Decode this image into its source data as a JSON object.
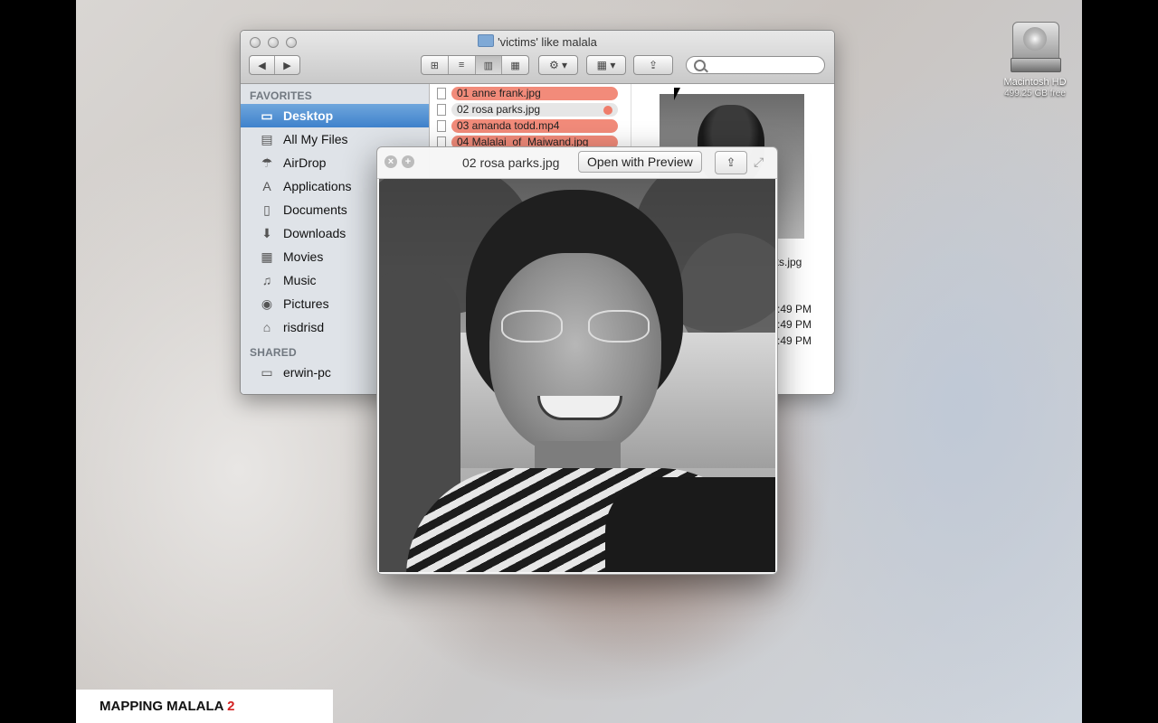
{
  "finder": {
    "title": "'victims' like malala",
    "toolbar": {
      "back": "◀",
      "forward": "▶",
      "view_icons": "⊞",
      "view_list": "≡",
      "view_columns": "▥",
      "view_coverflow": "▦",
      "action": "⚙ ▾",
      "arrange": "▦ ▾",
      "share": "⇪",
      "search_placeholder": ""
    },
    "sidebar": {
      "favorites_header": "FAVORITES",
      "items": [
        {
          "label": "Desktop",
          "icon": "▭"
        },
        {
          "label": "All My Files",
          "icon": "▤"
        },
        {
          "label": "AirDrop",
          "icon": "☂"
        },
        {
          "label": "Applications",
          "icon": "A"
        },
        {
          "label": "Documents",
          "icon": "▯"
        },
        {
          "label": "Downloads",
          "icon": "⬇"
        },
        {
          "label": "Movies",
          "icon": "▦"
        },
        {
          "label": "Music",
          "icon": "♫"
        },
        {
          "label": "Pictures",
          "icon": "◉"
        },
        {
          "label": "risdrisd",
          "icon": "⌂"
        }
      ],
      "shared_header": "SHARED",
      "shared_items": [
        {
          "label": "erwin-pc",
          "icon": "▭"
        }
      ]
    },
    "files": [
      {
        "name": "01 anne frank.jpg"
      },
      {
        "name": "02 rosa parks.jpg"
      },
      {
        "name": "03 amanda todd.mp4"
      },
      {
        "name": "04 Malalai_of_Maiwand.jpg"
      }
    ],
    "preview_info": {
      "name_fragment": "ks.jpg",
      "times": [
        ":49 PM",
        ":49 PM",
        ":49 PM"
      ]
    }
  },
  "quicklook": {
    "title": "02 rosa parks.jpg",
    "open_button": "Open with Preview",
    "close": "×",
    "fullscreen_glyph": "+",
    "share": "⇪",
    "expand": "⤢"
  },
  "desktop": {
    "drive_name": "Macintosh HD",
    "drive_free": "499.25 GB free"
  },
  "footer": {
    "title": "MAPPING MALALA",
    "number": "2"
  },
  "colors": {
    "label_red": "#f28b7a",
    "sidebar_selection": "#3f82cc",
    "footer_accent": "#d32222"
  }
}
